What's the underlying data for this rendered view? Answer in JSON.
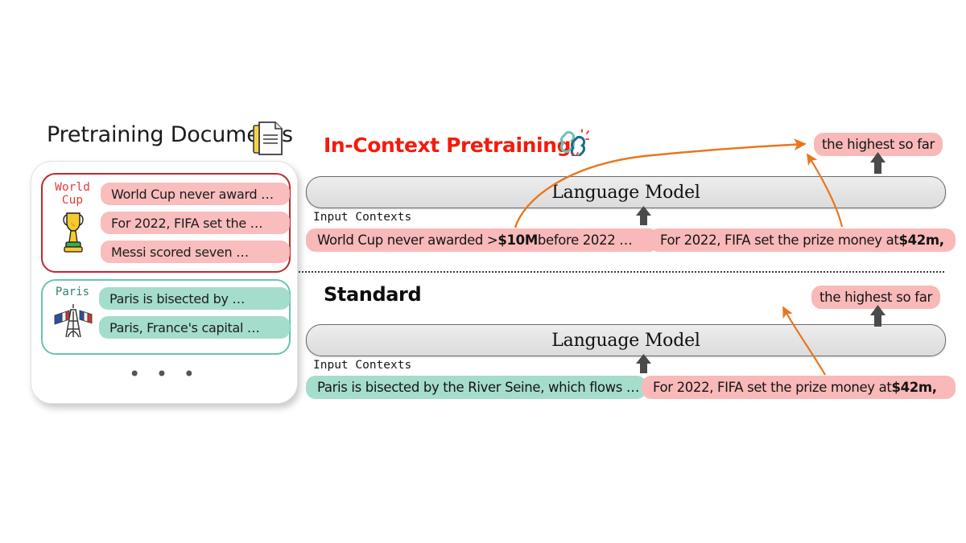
{
  "left_panel": {
    "title": "Pretraining Documents",
    "doc_icon": "documents-icon",
    "groups": [
      {
        "label": "World\nCup",
        "icon": "trophy-emoji",
        "color": "#c0272d",
        "chips": [
          "World Cup never award …",
          "For 2022, FIFA set the …",
          "Messi scored seven …"
        ]
      },
      {
        "label": "Paris",
        "icon": "eiffel-tower-emoji",
        "color": "#68c4b0",
        "chips": [
          "Paris is bisected by …",
          "Paris, France's capital …"
        ]
      }
    ],
    "more_indicator": "• • •"
  },
  "icp_panel": {
    "title": "In-Context Pretraining",
    "title_color": "#f41b0c",
    "link_icon": "link-emoji",
    "model_label": "Language Model",
    "input_contexts_label": "Input Contexts",
    "contexts": [
      {
        "prefix": "World Cup never awarded > ",
        "bold": "$10M",
        "suffix": " before 2022 …",
        "style": "pink"
      },
      {
        "prefix": "For 2022, FIFA set the prize money at  ",
        "bold": "$42m,",
        "suffix": "",
        "style": "pink"
      }
    ],
    "output": "the highest so far"
  },
  "standard_panel": {
    "title": "Standard",
    "title_color": "#0d0d0d",
    "model_label": "Language Model",
    "input_contexts_label": "Input Contexts",
    "contexts": [
      {
        "prefix": "Paris is bisected by the River Seine, which flows …",
        "bold": "",
        "suffix": "",
        "style": "teal"
      },
      {
        "prefix": "For 2022, FIFA set the prize money at  ",
        "bold": "$42m,",
        "suffix": "",
        "style": "pink"
      }
    ],
    "output": "the highest so far"
  },
  "colors": {
    "pink": "#f9b9b9",
    "teal": "#a5ddcd",
    "arrow_orange": "#e8761e",
    "arrow_gray": "#4a4a4a",
    "red_border": "#c0272d",
    "teal_border": "#68c4b0"
  }
}
